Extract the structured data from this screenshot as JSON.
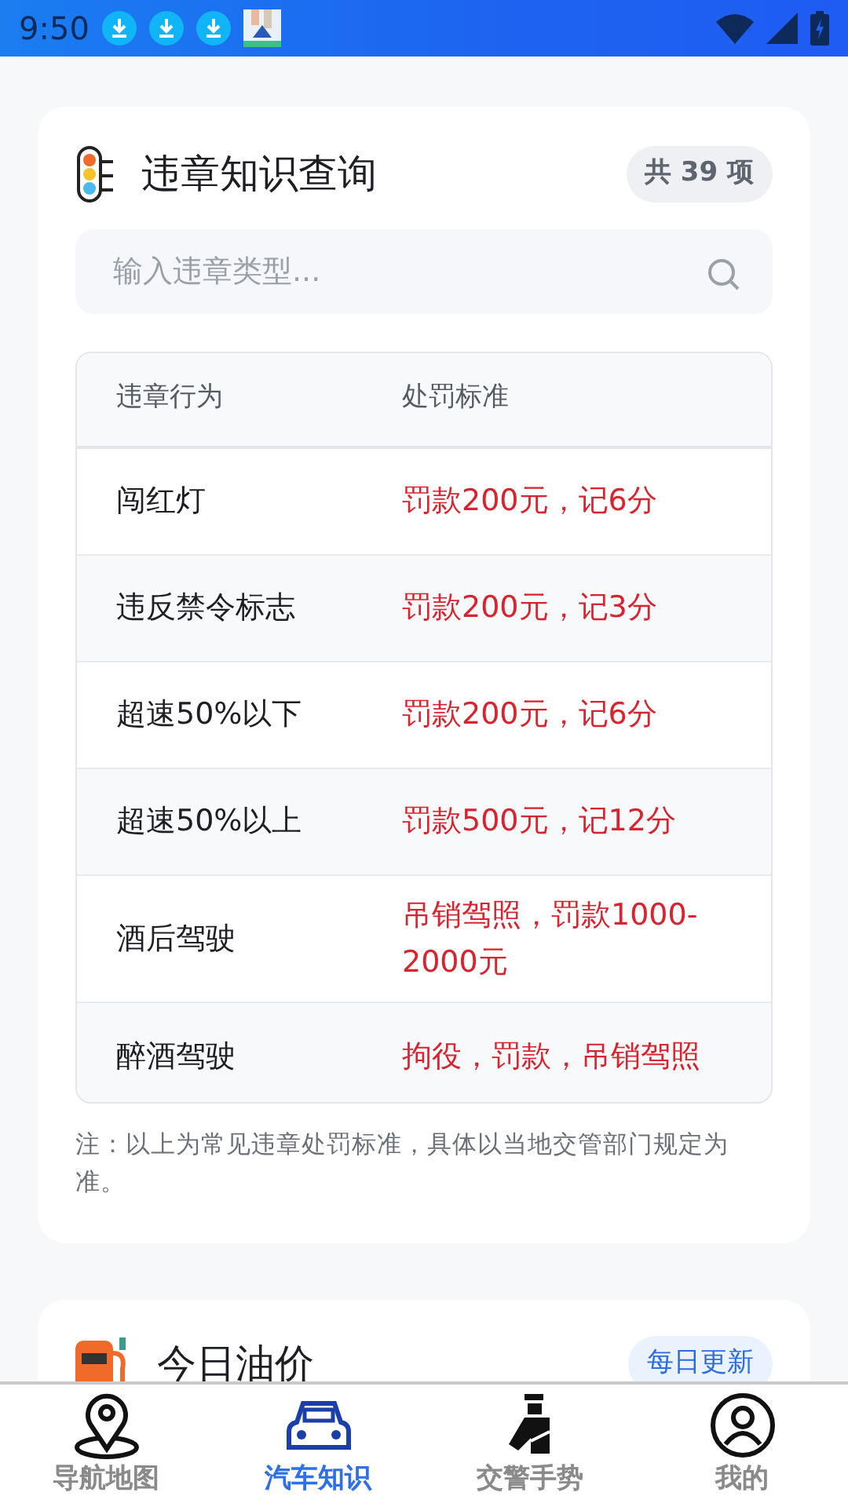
{
  "status_bar": {
    "time": "9:50",
    "notifications": [
      {
        "kind": "download"
      },
      {
        "kind": "download"
      },
      {
        "kind": "download"
      },
      {
        "kind": "picture"
      }
    ]
  },
  "violation_card": {
    "title": "违章知识查询",
    "count_badge": "共 39 项",
    "search": {
      "placeholder": "输入违章类型..."
    },
    "table": {
      "columns": [
        "违章行为",
        "处罚标准"
      ],
      "rows": [
        {
          "violation": "闯红灯",
          "penalty": "罚款200元，记6分"
        },
        {
          "violation": "违反禁令标志",
          "penalty": "罚款200元，记3分"
        },
        {
          "violation": "超速50%以下",
          "penalty": "罚款200元，记6分"
        },
        {
          "violation": "超速50%以上",
          "penalty": "罚款500元，记12分"
        },
        {
          "violation": "酒后驾驶",
          "penalty": "吊销驾照，罚款1000-2000元"
        },
        {
          "violation": "醉酒驾驶",
          "penalty": "拘役，罚款，吊销驾照"
        }
      ]
    },
    "note": "注：以上为常见违章处罚标准，具体以当地交管部门规定为准。"
  },
  "oil_card": {
    "title": "今日油价",
    "badge": "每日更新"
  },
  "bottom_nav": [
    {
      "label": "导航地图",
      "kind": "map",
      "selected": false
    },
    {
      "label": "汽车知识",
      "kind": "car",
      "selected": true
    },
    {
      "label": "交警手势",
      "kind": "police",
      "selected": false
    },
    {
      "label": "我的",
      "kind": "user",
      "selected": false
    }
  ]
}
